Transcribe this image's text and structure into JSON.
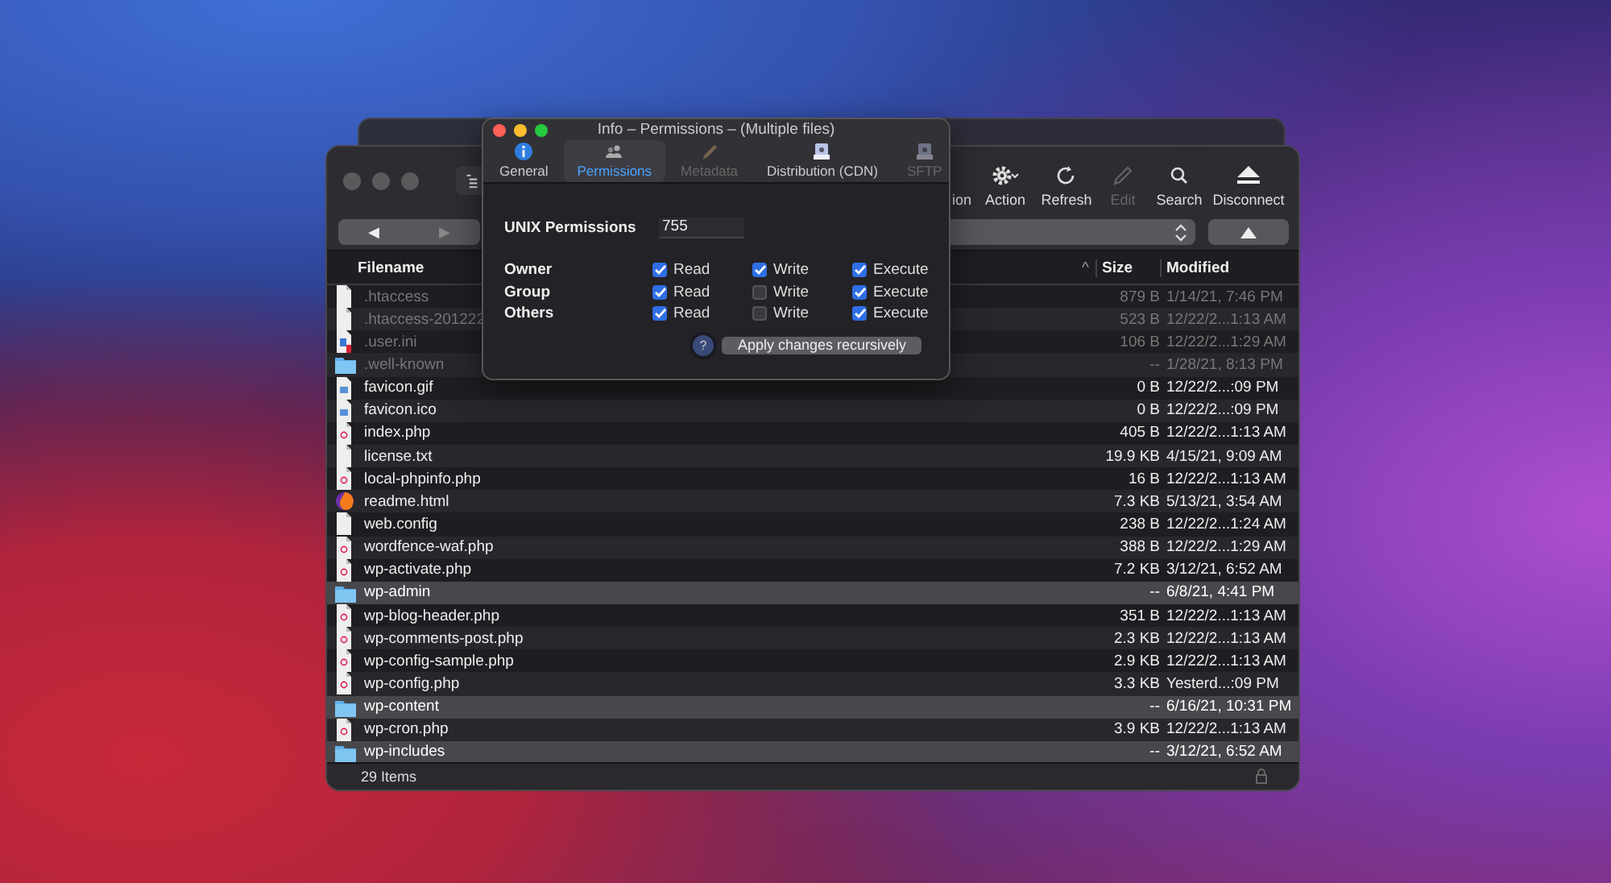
{
  "info_panel": {
    "title": "Info – Permissions – (Multiple files)",
    "tabs": [
      {
        "label": "General",
        "selected": false,
        "disabled": false
      },
      {
        "label": "Permissions",
        "selected": true,
        "disabled": false
      },
      {
        "label": "Metadata",
        "selected": false,
        "disabled": true
      },
      {
        "label": "Distribution (CDN)",
        "selected": false,
        "disabled": false
      },
      {
        "label": "SFTP",
        "selected": false,
        "disabled": true
      }
    ],
    "unix_label": "UNIX Permissions",
    "unix_value": "755",
    "permission_rows": [
      {
        "label": "Owner",
        "read": {
          "label": "Read",
          "checked": true
        },
        "write": {
          "label": "Write",
          "checked": true
        },
        "execute": {
          "label": "Execute",
          "checked": true
        }
      },
      {
        "label": "Group",
        "read": {
          "label": "Read",
          "checked": true
        },
        "write": {
          "label": "Write",
          "checked": false
        },
        "execute": {
          "label": "Execute",
          "checked": true
        }
      },
      {
        "label": "Others",
        "read": {
          "label": "Read",
          "checked": true
        },
        "write": {
          "label": "Write",
          "checked": false
        },
        "execute": {
          "label": "Execute",
          "checked": true
        }
      }
    ],
    "help_label": "?",
    "apply_button": "Apply changes recursively"
  },
  "browser": {
    "toolbar": [
      {
        "label": "ion",
        "disabled": false
      },
      {
        "label": "Action",
        "disabled": false
      },
      {
        "label": "Refresh",
        "disabled": false
      },
      {
        "label": "Edit",
        "disabled": true
      },
      {
        "label": "Search",
        "disabled": false
      },
      {
        "label": "Disconnect",
        "disabled": false
      }
    ],
    "nav_buttons": [
      {
        "label": "◀",
        "disabled": false
      },
      {
        "label": "▶",
        "disabled": true
      }
    ],
    "columns": [
      "Filename",
      "Size",
      "Modified"
    ],
    "sort_caret": "^",
    "rows": [
      {
        "name": ".htaccess",
        "size": "879 B",
        "modified": "1/14/21, 7:46 PM",
        "kind": "doc",
        "dimmed": true,
        "selected": false
      },
      {
        "name": ".htaccess-201222",
        "size": "523 B",
        "modified": "12/22/2...1:13 AM",
        "kind": "doc",
        "dimmed": true,
        "selected": false
      },
      {
        "name": ".user.ini",
        "size": "106 B",
        "modified": "12/22/2...1:29 AM",
        "kind": "ini",
        "dimmed": true,
        "selected": false
      },
      {
        "name": ".well-known",
        "size": "--",
        "modified": "1/28/21, 8:13 PM",
        "kind": "folder",
        "dimmed": true,
        "selected": false
      },
      {
        "name": "favicon.gif",
        "size": "0 B",
        "modified": "12/22/2...:09 PM",
        "kind": "image",
        "dimmed": false,
        "selected": false
      },
      {
        "name": "favicon.ico",
        "size": "0 B",
        "modified": "12/22/2...:09 PM",
        "kind": "image",
        "dimmed": false,
        "selected": false
      },
      {
        "name": "index.php",
        "size": "405 B",
        "modified": "12/22/2...1:13 AM",
        "kind": "php",
        "dimmed": false,
        "selected": false
      },
      {
        "name": "license.txt",
        "size": "19.9 KB",
        "modified": "4/15/21, 9:09 AM",
        "kind": "doc",
        "dimmed": false,
        "selected": false
      },
      {
        "name": "local-phpinfo.php",
        "size": "16 B",
        "modified": "12/22/2...1:13 AM",
        "kind": "php",
        "dimmed": false,
        "selected": false
      },
      {
        "name": "readme.html",
        "size": "7.3 KB",
        "modified": "5/13/21, 3:54 AM",
        "kind": "web",
        "dimmed": false,
        "selected": false
      },
      {
        "name": "web.config",
        "size": "238 B",
        "modified": "12/22/2...1:24 AM",
        "kind": "doc",
        "dimmed": false,
        "selected": false
      },
      {
        "name": "wordfence-waf.php",
        "size": "388 B",
        "modified": "12/22/2...1:29 AM",
        "kind": "php",
        "dimmed": false,
        "selected": false
      },
      {
        "name": "wp-activate.php",
        "size": "7.2 KB",
        "modified": "3/12/21, 6:52 AM",
        "kind": "php",
        "dimmed": false,
        "selected": false
      },
      {
        "name": "wp-admin",
        "size": "--",
        "modified": "6/8/21, 4:41 PM",
        "kind": "folder",
        "dimmed": false,
        "selected": true
      },
      {
        "name": "wp-blog-header.php",
        "size": "351 B",
        "modified": "12/22/2...1:13 AM",
        "kind": "php",
        "dimmed": false,
        "selected": false
      },
      {
        "name": "wp-comments-post.php",
        "size": "2.3 KB",
        "modified": "12/22/2...1:13 AM",
        "kind": "php",
        "dimmed": false,
        "selected": false
      },
      {
        "name": "wp-config-sample.php",
        "size": "2.9 KB",
        "modified": "12/22/2...1:13 AM",
        "kind": "php",
        "dimmed": false,
        "selected": false
      },
      {
        "name": "wp-config.php",
        "size": "3.3 KB",
        "modified": "Yesterd...:09 PM",
        "kind": "php",
        "dimmed": false,
        "selected": false
      },
      {
        "name": "wp-content",
        "size": "--",
        "modified": "6/16/21, 10:31 PM",
        "kind": "folder",
        "dimmed": false,
        "selected": true
      },
      {
        "name": "wp-cron.php",
        "size": "3.9 KB",
        "modified": "12/22/2...1:13 AM",
        "kind": "php",
        "dimmed": false,
        "selected": false
      },
      {
        "name": "wp-includes",
        "size": "--",
        "modified": "3/12/21, 6:52 AM",
        "kind": "folder",
        "dimmed": false,
        "selected": true
      }
    ],
    "status": "29 Items"
  }
}
